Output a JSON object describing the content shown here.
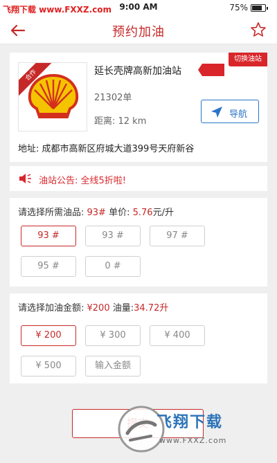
{
  "status_bar": {
    "watermark": "飞翔下载 www.FXXZ.com",
    "time": "9:00 AM",
    "battery": "75%",
    "battery_level": 0.75
  },
  "header": {
    "title": "预约加油",
    "back_icon": "arrow-left-icon",
    "favorite_icon": "star-icon"
  },
  "station": {
    "badge": "合作",
    "name": "延长壳牌高新加油站",
    "switch_label": "切换油站",
    "orders": "21302单",
    "distance": "距离: 12 km",
    "navigate_label": "导航",
    "address": "地址: 成都市高新区府城大道399号天府新谷"
  },
  "notice": {
    "icon": "speaker-icon",
    "text": "油站公告: 全线5折啦!"
  },
  "fuel": {
    "prefix": "请选择所需油品: ",
    "selected": "93#",
    "price_label": " 单价: ",
    "price": "5.76",
    "price_unit": "元/升",
    "options": [
      "93 #",
      "93 #",
      "97 #",
      "95 #",
      "0 #"
    ],
    "selected_index": 0
  },
  "amount": {
    "prefix": "请选择加油金额: ",
    "selected": "¥200",
    "volume_label": " 油量:",
    "volume": "34.72升",
    "options": [
      "¥ 200",
      "¥ 300",
      "¥ 400",
      "¥ 500"
    ],
    "custom_label": "输入金额",
    "selected_index": 0
  },
  "bottom": {
    "button_label": "提交"
  },
  "watermark_bottom": {
    "text": "飞翔下载",
    "url": "www.FXXZ.com"
  },
  "colors": {
    "accent": "#c62828",
    "blue": "#2a73c8",
    "background": "#efefef"
  }
}
